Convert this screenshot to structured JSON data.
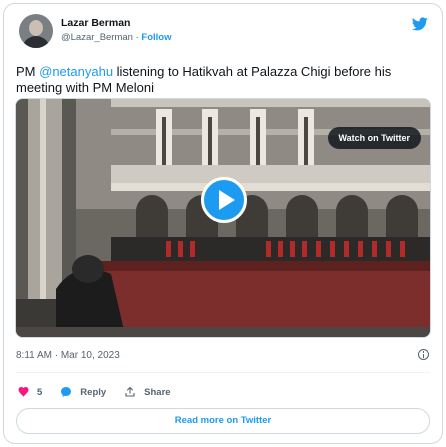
{
  "author": {
    "name": "Lazar Berman",
    "handle": "@Lazar_Berman",
    "separator": "·",
    "follow_label": "Follow",
    "avatar_icon": "avatar-photo"
  },
  "platform_icon": "twitter-bird-icon",
  "tweet": {
    "text_prefix": "PM ",
    "mention": "@netanyahu",
    "text_suffix": " listening to Hatikvah at Palazza Chigi before his meeting with PM Meloni"
  },
  "media": {
    "watch_label": "Watch on Twitter",
    "play_icon": "play-icon"
  },
  "meta": {
    "timestamp": "8:11 AM · Mar 10, 2023",
    "info_icon": "info-icon"
  },
  "actions": {
    "like_count": "5",
    "reply_label": "Reply",
    "share_label": "Share"
  },
  "read_more_label": "Read more on Twitter",
  "colors": {
    "accent": "#1d9bf0",
    "like": "#f91880",
    "text": "#0f1419",
    "secondary": "#536471",
    "border": "#cfd9de"
  }
}
